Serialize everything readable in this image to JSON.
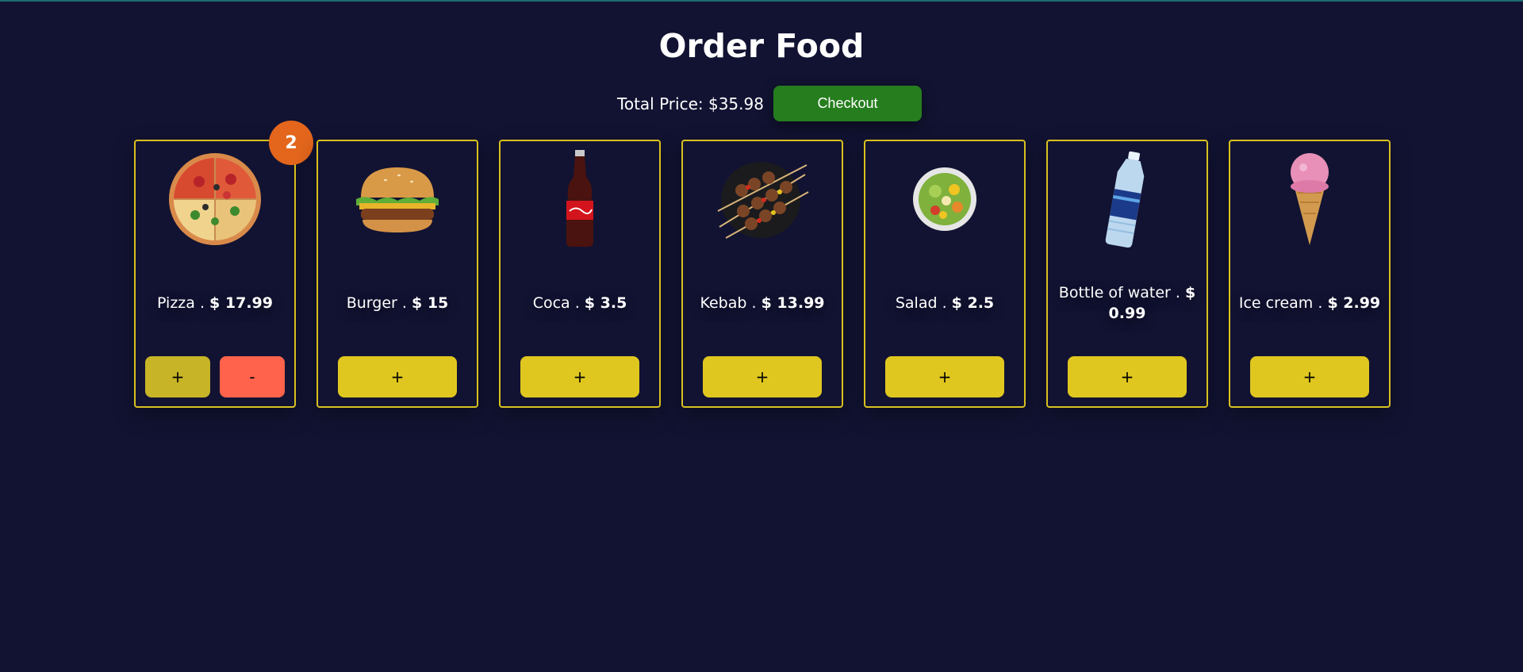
{
  "page": {
    "title": "Order Food",
    "total_label": "Total Price: $35.98",
    "checkout_label": "Checkout",
    "colors": {
      "background": "#121332",
      "card_border": "#d9c11f",
      "add_button": "#e0c720",
      "remove_button": "#ff634c",
      "checkout_button": "#267d1e",
      "badge": "#e3661c"
    }
  },
  "items": [
    {
      "name": "Pizza .",
      "price": "$ 17.99",
      "icon": "pizza-icon",
      "quantity": "2",
      "add_label": "+",
      "remove_label": "-"
    },
    {
      "name": "Burger .",
      "price": "$ 15",
      "icon": "burger-icon",
      "add_label": "+"
    },
    {
      "name": "Coca .",
      "price": "$ 3.5",
      "icon": "cola-bottle-icon",
      "add_label": "+"
    },
    {
      "name": "Kebab .",
      "price": "$ 13.99",
      "icon": "kebab-icon",
      "add_label": "+"
    },
    {
      "name": "Salad .",
      "price": "$ 2.5",
      "icon": "salad-icon",
      "add_label": "+"
    },
    {
      "name": "Bottle of water .",
      "price": "$ 0.99",
      "icon": "water-bottle-icon",
      "add_label": "+"
    },
    {
      "name": "Ice cream .",
      "price": "$ 2.99",
      "icon": "ice-cream-icon",
      "add_label": "+"
    }
  ]
}
